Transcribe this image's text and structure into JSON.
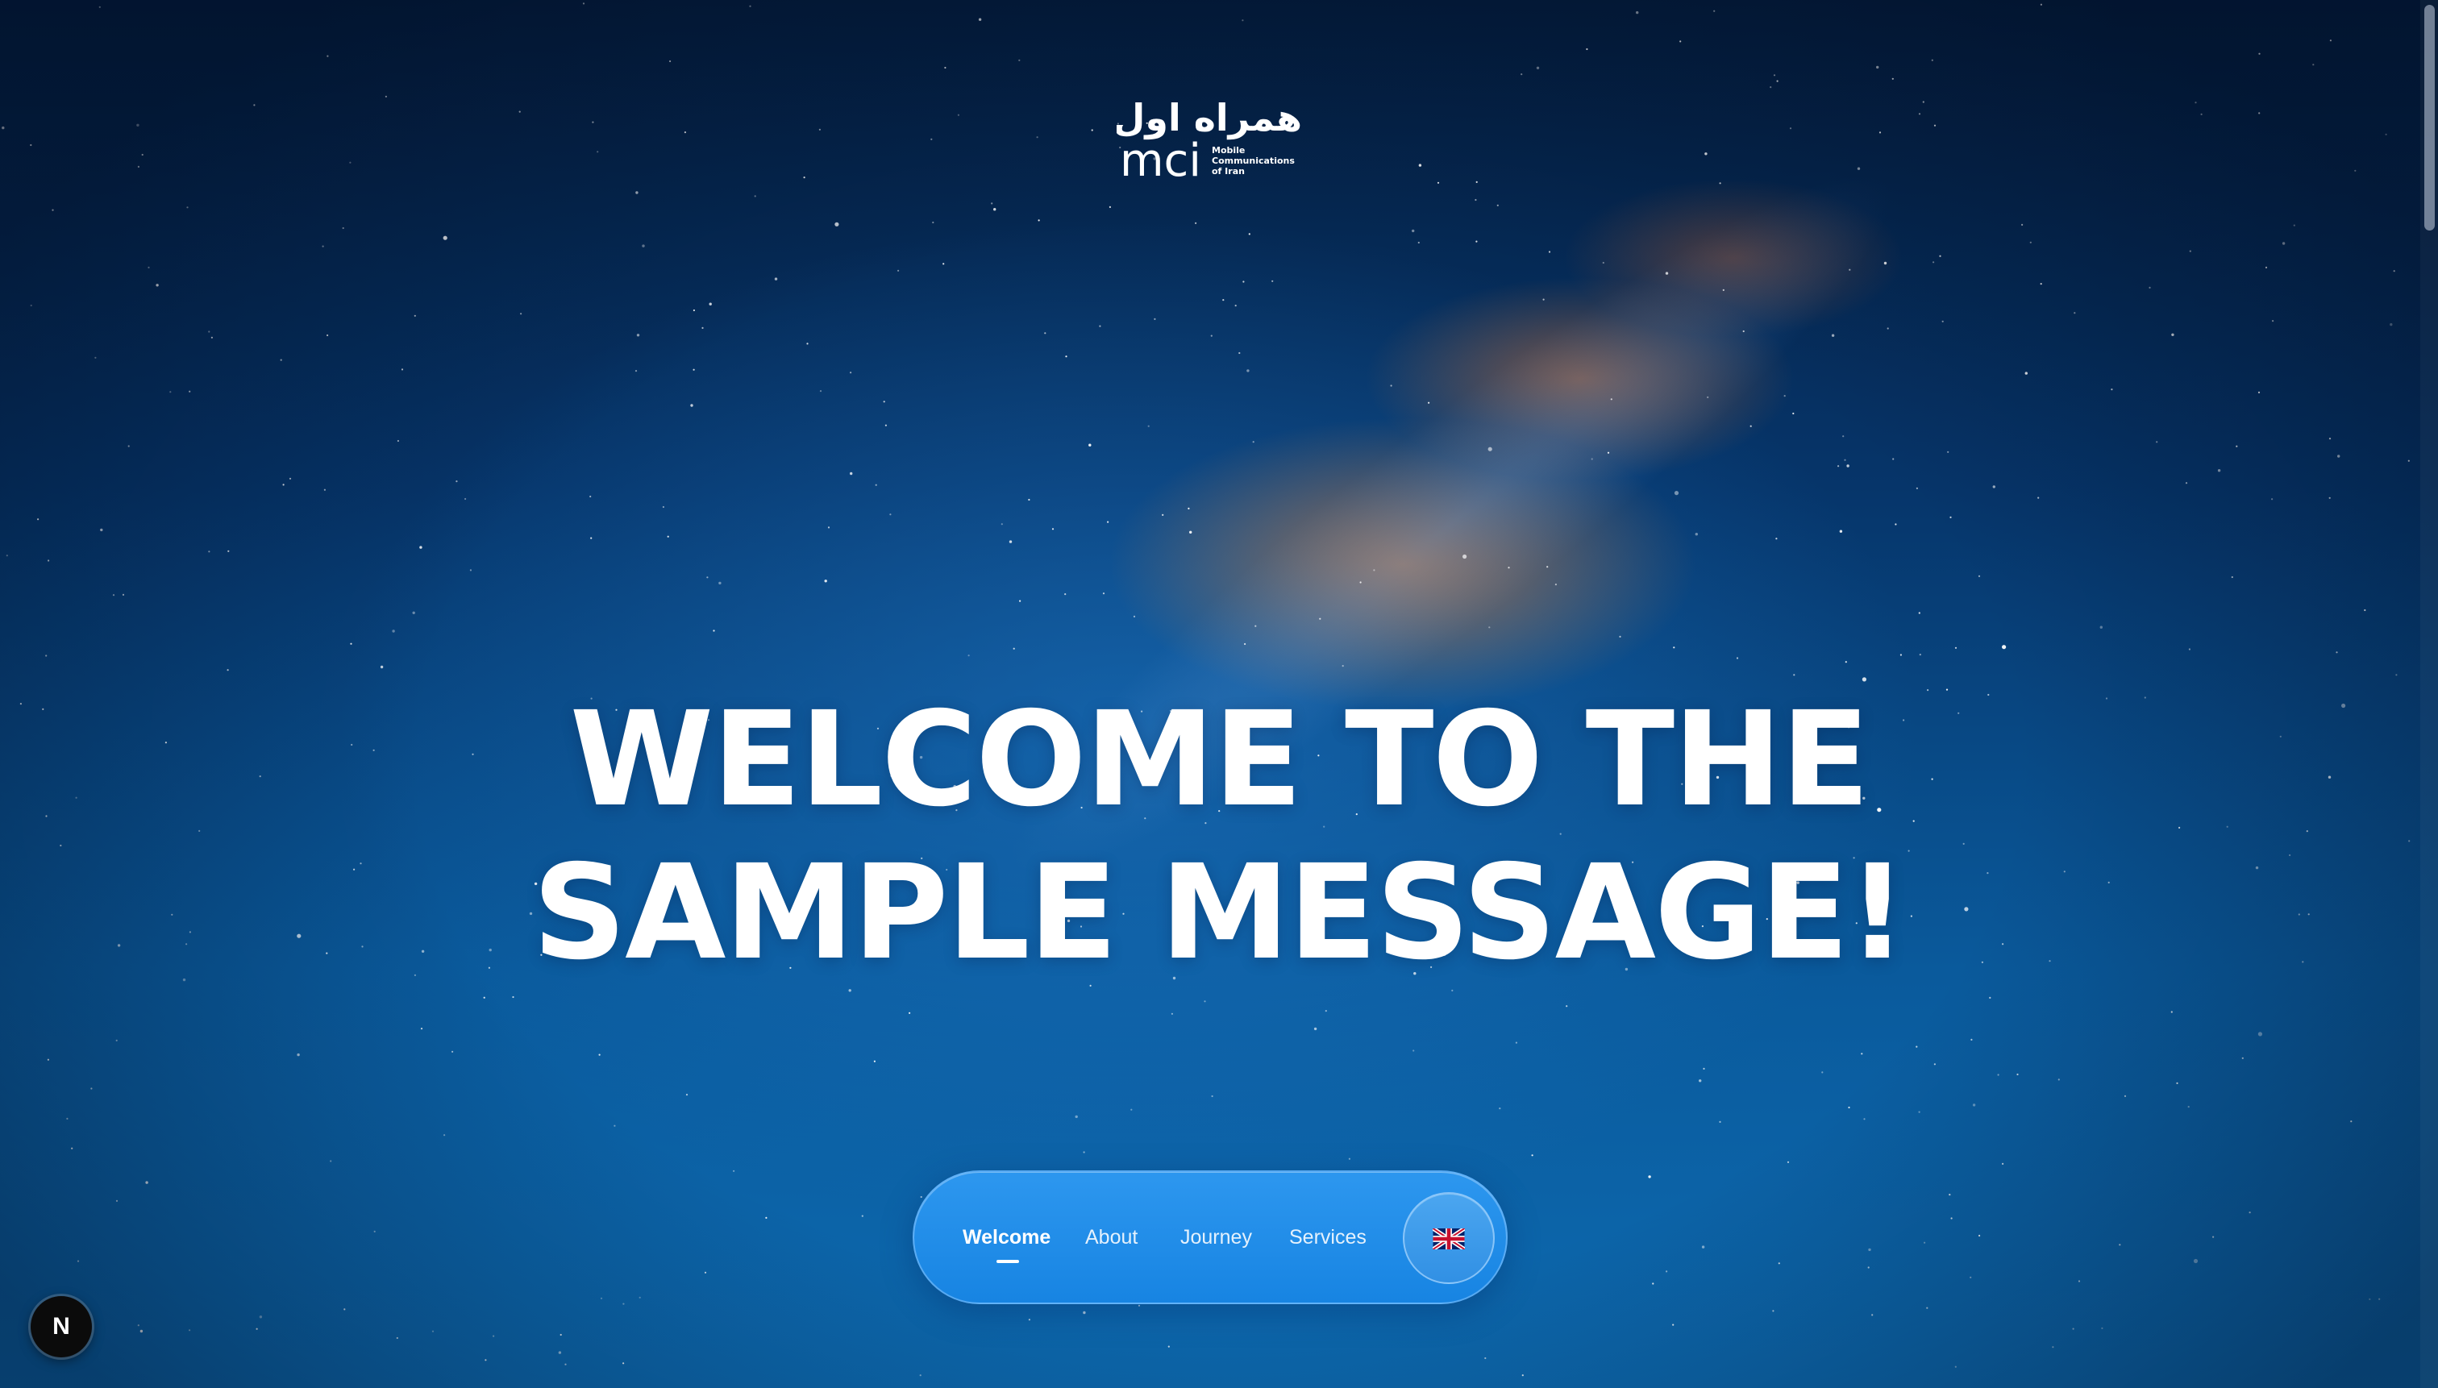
{
  "brand": {
    "logo_text_fa": "همراه اول",
    "logo_mark": "mci",
    "logo_tagline_lines": [
      "Mobile",
      "Communications",
      "of Iran"
    ]
  },
  "hero": {
    "line1": "WELCOME TO THE",
    "line2": "SAMPLE MESSAGE!"
  },
  "nav": {
    "items": [
      {
        "label": "Welcome",
        "active": true
      },
      {
        "label": "About",
        "active": false
      },
      {
        "label": "Journey",
        "active": false
      },
      {
        "label": "Services",
        "active": false
      }
    ],
    "language_icon": "uk-flag-icon"
  },
  "dev_badge": {
    "label": "N",
    "icon": "nextjs-icon"
  },
  "colors": {
    "nav_bg": "#1f8ce8",
    "text": "#ffffff",
    "sky_top": "#041d3e",
    "sky_bottom": "#0d6ab0",
    "nebula": "#ff8c32"
  }
}
